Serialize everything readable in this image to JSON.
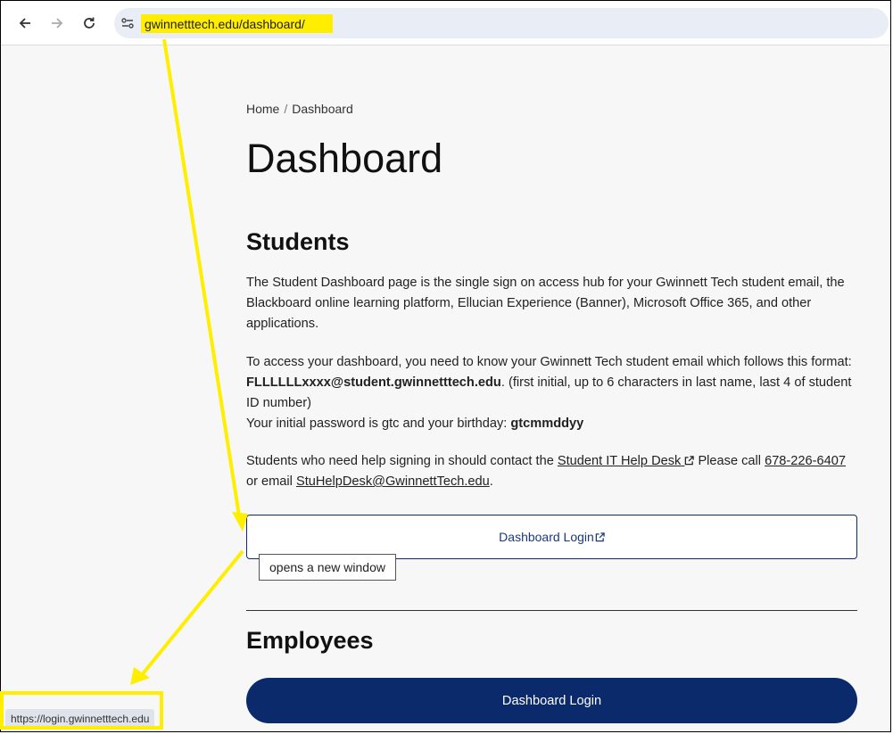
{
  "browser": {
    "url": "gwinnetttech.edu/dashboard/",
    "status_url": "https://login.gwinnetttech.edu"
  },
  "breadcrumb": {
    "home": "Home",
    "separator": "/",
    "current": "Dashboard"
  },
  "page_title": "Dashboard",
  "students": {
    "heading": "Students",
    "intro": "The Student Dashboard page is the single sign on access hub for your Gwinnett Tech student email, the Blackboard online learning platform, Ellucian Experience (Banner), Microsoft Office 365, and other applications.",
    "access_before": "To access your dashboard, you need to know your Gwinnett Tech student email which follows this format: ",
    "email_format": "FLLLLLLxxxx@student.gwinnetttech.edu",
    "access_after": ". (first initial, up to 6 characters in last name, last 4 of student ID number)",
    "password_before": "Your initial password is gtc and your birthday: ",
    "password_format": "gtcmmddyy",
    "help_before": "Students who need help signing in should contact the ",
    "help_link": "Student IT Help Desk",
    "help_call": " Please call ",
    "phone": "678-226-6407",
    "help_or": " or email ",
    "email_link": "StuHelpDesk@GwinnettTech.edu",
    "help_end": ".",
    "login_button": "Dashboard Login",
    "tooltip": "opens a new window"
  },
  "employees": {
    "heading": "Employees",
    "login_button": "Dashboard Login"
  },
  "colors": {
    "brand_navy": "#0b2a6b",
    "annotation_yellow": "#ffee00"
  }
}
